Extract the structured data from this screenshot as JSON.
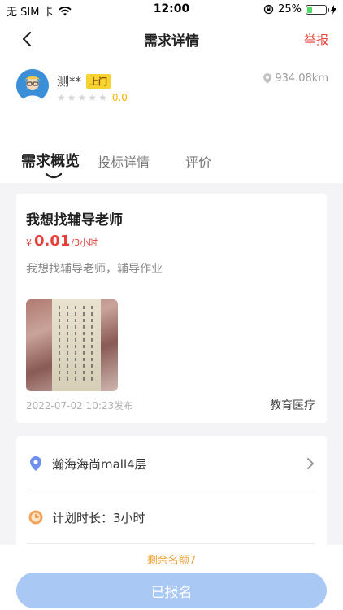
{
  "status_bar": {
    "carrier": "无 SIM 卡",
    "time": "12:00",
    "battery": "25%",
    "battery_level": 0.25
  },
  "nav": {
    "title": "需求详情",
    "report": "举报"
  },
  "user": {
    "name": "测**",
    "badge": "上门",
    "rating": "0.0",
    "distance": "934.08km"
  },
  "tabs": [
    {
      "label": "需求概览"
    },
    {
      "label": "投标详情"
    },
    {
      "label": "评价"
    }
  ],
  "detail": {
    "title": "我想找辅导老师",
    "currency": "¥",
    "price": "0.01",
    "unit": "/3小时",
    "description": "我想找辅导老师，辅导作业",
    "posted": "2022-07-02 10:23发布",
    "category": "教育医疗"
  },
  "info": {
    "location": "瀚海海尚mall4层",
    "duration": "计划时长：3小时"
  },
  "bottom": {
    "remaining": "剩余名额7",
    "button": "已报名"
  },
  "colors": {
    "accent_red": "#e8413b",
    "badge_yellow": "#f7d331",
    "button_blue": "#a9c8f3",
    "remaining_orange": "#f0a030"
  }
}
